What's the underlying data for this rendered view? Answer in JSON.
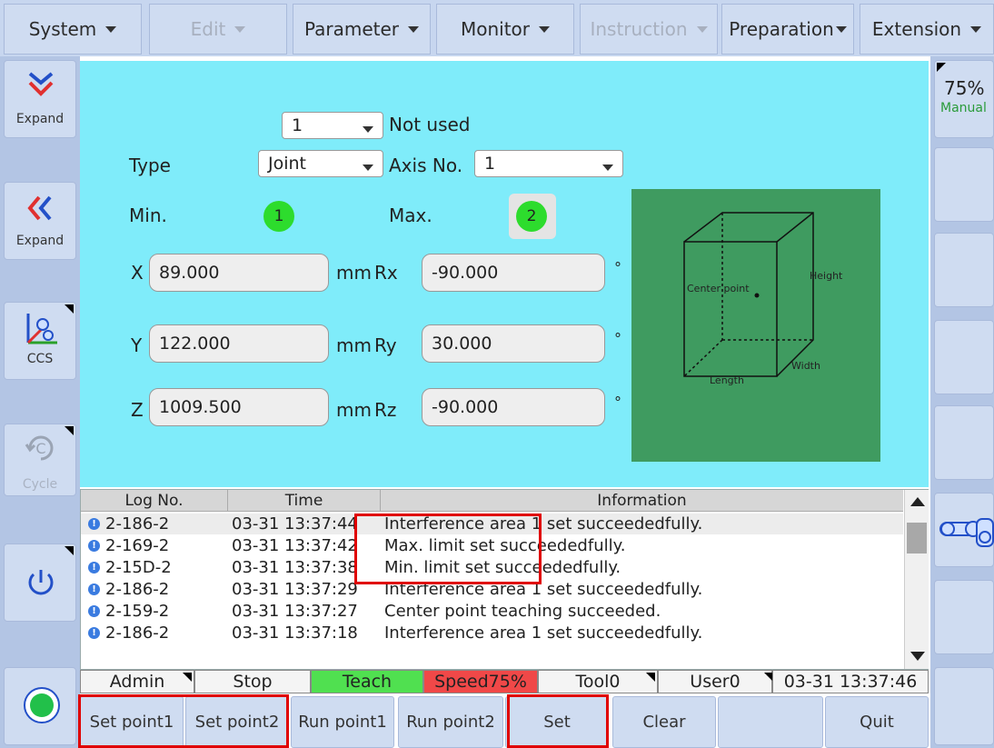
{
  "menu": {
    "items": [
      {
        "label": "System",
        "disabled": false
      },
      {
        "label": "Edit",
        "disabled": true
      },
      {
        "label": "Parameter",
        "disabled": false
      },
      {
        "label": "Monitor",
        "disabled": false
      },
      {
        "label": "Instruction",
        "disabled": true
      },
      {
        "label": "Preparation",
        "disabled": false
      },
      {
        "label": "Extension",
        "disabled": false
      }
    ]
  },
  "left_sidebar": {
    "expand_down_label": "Expand",
    "expand_left_label": "Expand",
    "ccs_label": "CCS",
    "cycle_label": "Cycle"
  },
  "right_sidebar": {
    "speed": "75%",
    "mode": "Manual"
  },
  "form": {
    "area_no": "1",
    "area_status": "Not used",
    "type_label": "Type",
    "type_value": "Joint",
    "axis_label": "Axis No.",
    "axis_value": "1",
    "min_label": "Min.",
    "min_point": "1",
    "max_label": "Max.",
    "max_point": "2",
    "x_label": "X",
    "x_value": "89.000",
    "x_unit": "mm",
    "y_label": "Y",
    "y_value": "122.000",
    "y_unit": "mm",
    "z_label": "Z",
    "z_value": "1009.500",
    "z_unit": "mm",
    "rx_label": "Rx",
    "rx_value": "-90.000",
    "ry_label": "Ry",
    "ry_value": "30.000",
    "rz_label": "Rz",
    "rz_value": "-90.000",
    "deg_unit": "°"
  },
  "diagram": {
    "center_label": "Center point",
    "height_label": "Height",
    "width_label": "Width",
    "length_label": "Length"
  },
  "log": {
    "headers": [
      "Log No.",
      "Time",
      "Information"
    ],
    "rows": [
      {
        "no": "2-186-2",
        "time": "03-31 13:37:44",
        "info": "Interference area 1 set succeededfully."
      },
      {
        "no": "2-169-2",
        "time": "03-31 13:37:42",
        "info": "Max. limit set succeededfully."
      },
      {
        "no": "2-15D-2",
        "time": "03-31 13:37:38",
        "info": "Min. limit set succeededfully."
      },
      {
        "no": "2-186-2",
        "time": "03-31 13:37:29",
        "info": "Interference area 1 set succeededfully."
      },
      {
        "no": "2-159-2",
        "time": "03-31 13:37:27",
        "info": "Center point teaching succeeded."
      },
      {
        "no": "2-186-2",
        "time": "03-31 13:37:18",
        "info": "Interference area 1 set succeededfully."
      }
    ]
  },
  "status": {
    "user": "Admin",
    "state": "Stop",
    "mode": "Teach",
    "speed": "Speed75%",
    "tool": "Tool0",
    "frame": "User0",
    "clock": "03-31 13:37:46"
  },
  "buttons": {
    "set_point1": "Set point1",
    "set_point2": "Set point2",
    "run_point1": "Run point1",
    "run_point2": "Run point2",
    "set": "Set",
    "clear": "Clear",
    "blank": "",
    "quit": "Quit"
  },
  "colors": {
    "panel": "#7fecfa",
    "teach": "#50e050",
    "speed": "#f04848",
    "highlight": "#e00000"
  }
}
